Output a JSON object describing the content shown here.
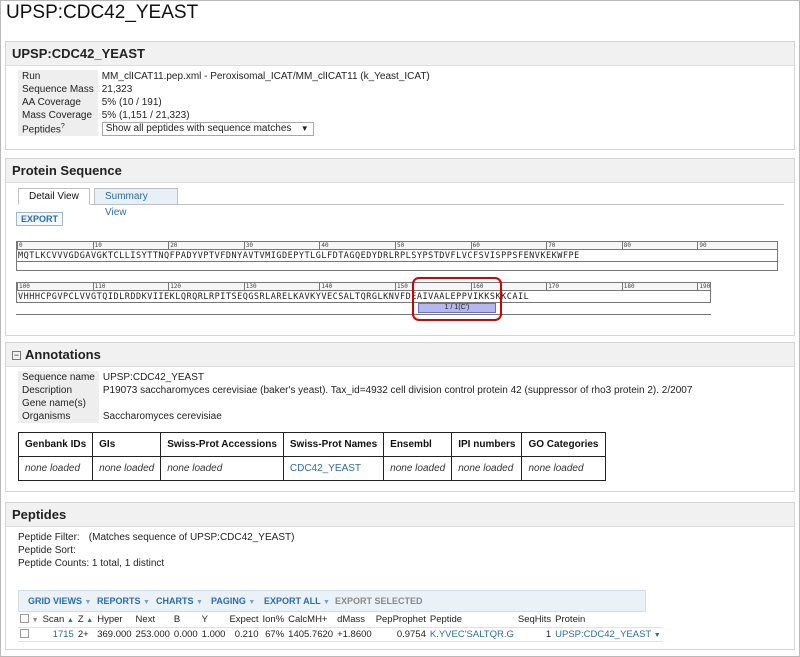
{
  "page": {
    "title": "UPSP:CDC42_YEAST"
  },
  "protein_info": {
    "header": "UPSP:CDC42_YEAST",
    "rows": [
      {
        "label": "Run",
        "value": "MM_clICAT11.pep.xml - Peroxisomal_ICAT/MM_clICAT11 (k_Yeast_ICAT)"
      },
      {
        "label": "Sequence Mass",
        "value": "21,323"
      },
      {
        "label": "AA Coverage",
        "value": "5% (10 / 191)"
      },
      {
        "label": "Mass Coverage",
        "value": "5% (1,151 / 21,323)"
      }
    ],
    "peptides_label": "Peptides",
    "peptides_help": "?",
    "peptides_select": "Show all peptides with sequence matches"
  },
  "sequence": {
    "header": "Protein Sequence",
    "tabs": [
      "Detail View",
      "Summary View"
    ],
    "export_label": "EXPORT",
    "row1_ticks": [
      "0",
      "10",
      "20",
      "30",
      "40",
      "50",
      "60",
      "70",
      "80",
      "90"
    ],
    "row1_residues": "MQTLKCVVVGDGAVGKTCLLISYTTNQFPADYVPTVFDNYAVTVMIGDEPYTLGLFDTAGQEDYDRLRPLSYPSTDVFLVCFSVISPPSFENVKEKWFPE",
    "row2_ticks": [
      "100",
      "110",
      "120",
      "130",
      "140",
      "150",
      "160",
      "170",
      "180",
      "190"
    ],
    "row2_residues": "VHHHCPGVPCLVVGTQIDLRDDKVIIEKLQRQRLRPITSEQGSRLARELKAVKYVECSALTQRGLKNVFDEAIVAALEPPVIKKSKKCAIL",
    "peptide_label": "1 / 1(C')"
  },
  "annotations": {
    "header": "Annotations",
    "rows": [
      {
        "label": "Sequence name",
        "value": "UPSP:CDC42_YEAST"
      },
      {
        "label": "Description",
        "value": "P19073 saccharomyces cerevisiae (baker's yeast). Tax_id=4932 cell division control protein 42 (suppressor of rho3 protein 2). 2/2007"
      },
      {
        "label": "Gene name(s)",
        "value": ""
      },
      {
        "label": "Organisms",
        "value": "Saccharomyces cerevisiae"
      }
    ],
    "columns": [
      "Genbank IDs",
      "GIs",
      "Swiss-Prot Accessions",
      "Swiss-Prot Names",
      "Ensembl",
      "IPI numbers",
      "GO Categories"
    ],
    "cells": [
      "none loaded",
      "none loaded",
      "none loaded",
      "CDC42_YEAST",
      "none loaded",
      "none loaded",
      "none loaded"
    ]
  },
  "peptides": {
    "header": "Peptides",
    "filter_label": "Peptide Filter:",
    "filter_value": "(Matches sequence of UPSP:CDC42_YEAST)",
    "sort_label": "Peptide Sort:",
    "counts": "Peptide Counts: 1 total, 1 distinct",
    "toolbar": {
      "grid_views": "GRID VIEWS",
      "reports": "REPORTS",
      "charts": "CHARTS",
      "paging": "PAGING",
      "export_all": "EXPORT ALL",
      "export_selected": "EXPORT SELECTED"
    },
    "columns": [
      "Scan",
      "Z",
      "Hyper",
      "Next",
      "B",
      "Y",
      "Expect",
      "Ion%",
      "CalcMH+",
      "dMass",
      "PepProphet",
      "Peptide",
      "SeqHits",
      "Protein"
    ],
    "row": [
      "1715",
      "2+",
      "369.000",
      "253.000",
      "0.000",
      "1.000",
      "0.210",
      "67%",
      "1405.7620",
      "+1.8600",
      "0.9754",
      "K.YVEC'SALTQR.G",
      "1",
      "UPSP:CDC42_YEAST"
    ]
  },
  "colors": {
    "link": "#2a6cb0",
    "highlight": "#d60000",
    "peptide_bar": "#b7b7f0"
  }
}
